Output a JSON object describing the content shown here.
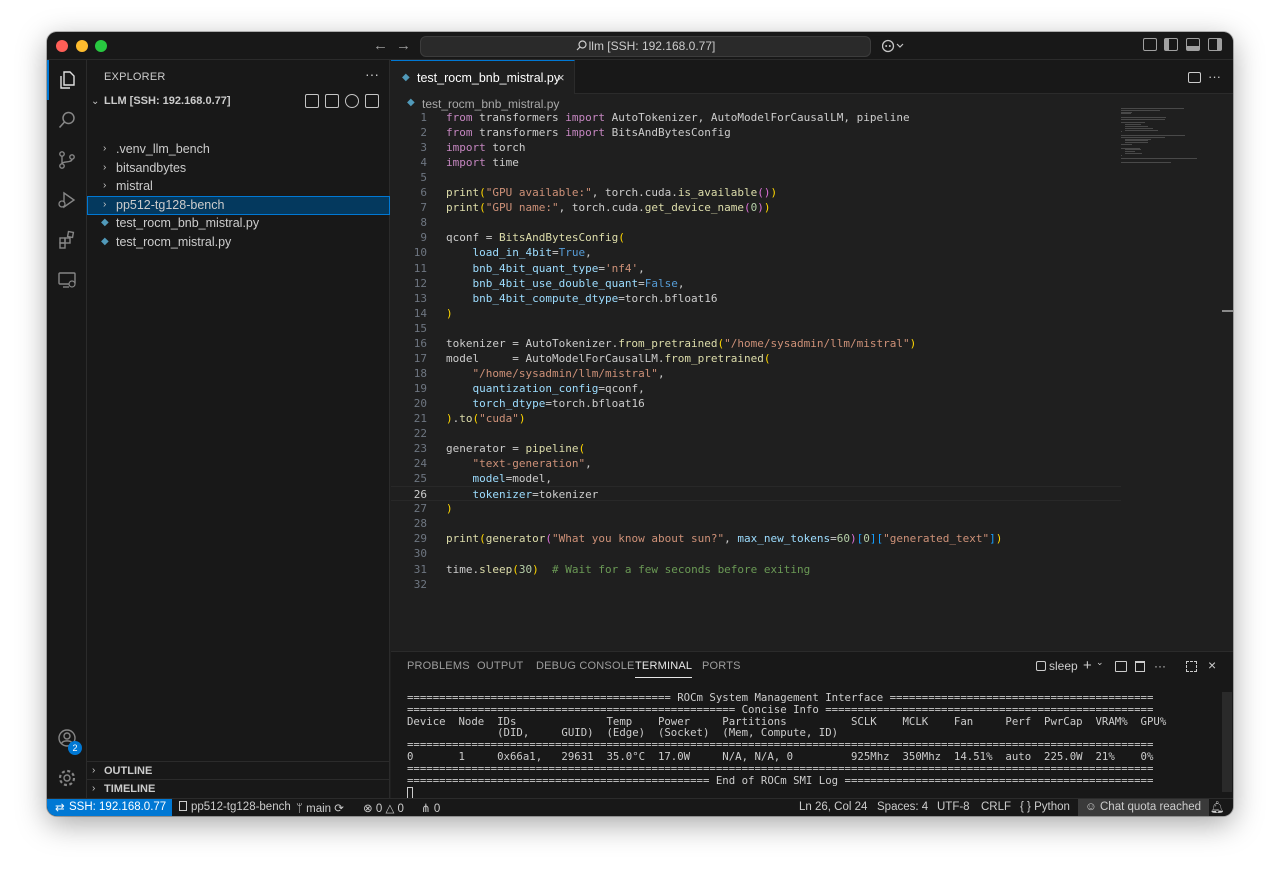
{
  "titlebar": {
    "command_center": "llm [SSH: 192.168.0.77]",
    "back_glyph": "←",
    "forward_glyph": "→"
  },
  "activity_bar": {
    "accounts_badge": "2"
  },
  "explorer": {
    "title": "EXPLORER",
    "more": "···",
    "root": "LLM [SSH: 192.168.0.77]",
    "items": [
      {
        "label": ".venv_llm_bench",
        "type": "folder"
      },
      {
        "label": "bitsandbytes",
        "type": "folder"
      },
      {
        "label": "mistral",
        "type": "folder"
      },
      {
        "label": "pp512-tg128-bench",
        "type": "folder",
        "selected": true
      },
      {
        "label": "test_rocm_bnb_mistral.py",
        "type": "python-file"
      },
      {
        "label": "test_rocm_mistral.py",
        "type": "python-file"
      }
    ],
    "outline": "OUTLINE",
    "timeline": "TIMELINE"
  },
  "editor": {
    "tab_label": "test_rocm_bnb_mistral.py",
    "tab_close": "×",
    "breadcrumb": "test_rocm_bnb_mistral.py",
    "current_line": 26,
    "lines": [
      [
        [
          "kw",
          "from"
        ],
        [
          "plain",
          " transformers "
        ],
        [
          "kw",
          "import"
        ],
        [
          "plain",
          " AutoTokenizer, AutoModelForCausalLM, pipeline"
        ]
      ],
      [
        [
          "kw",
          "from"
        ],
        [
          "plain",
          " transformers "
        ],
        [
          "kw",
          "import"
        ],
        [
          "plain",
          " BitsAndBytesConfig"
        ]
      ],
      [
        [
          "kw",
          "import"
        ],
        [
          "plain",
          " torch"
        ]
      ],
      [
        [
          "kw",
          "import"
        ],
        [
          "plain",
          " time"
        ]
      ],
      [],
      [
        [
          "fn",
          "print"
        ],
        [
          "br1",
          "("
        ],
        [
          "str",
          "\"GPU available:\""
        ],
        [
          "plain",
          ", torch.cuda."
        ],
        [
          "fn",
          "is_available"
        ],
        [
          "br2",
          "()"
        ],
        [
          "br1",
          ")"
        ]
      ],
      [
        [
          "fn",
          "print"
        ],
        [
          "br1",
          "("
        ],
        [
          "str",
          "\"GPU name:\""
        ],
        [
          "plain",
          ", torch.cuda."
        ],
        [
          "fn",
          "get_device_name"
        ],
        [
          "br2",
          "("
        ],
        [
          "num",
          "0"
        ],
        [
          "br2",
          ")"
        ],
        [
          "br1",
          ")"
        ]
      ],
      [],
      [
        [
          "plain",
          "qconf = "
        ],
        [
          "fn",
          "BitsAndBytesConfig"
        ],
        [
          "br1",
          "("
        ]
      ],
      [
        [
          "plain",
          "    "
        ],
        [
          "par",
          "load_in_4bit"
        ],
        [
          "plain",
          "="
        ],
        [
          "bool",
          "True"
        ],
        [
          "plain",
          ","
        ]
      ],
      [
        [
          "plain",
          "    "
        ],
        [
          "par",
          "bnb_4bit_quant_type"
        ],
        [
          "plain",
          "="
        ],
        [
          "str",
          "'nf4'"
        ],
        [
          "plain",
          ","
        ]
      ],
      [
        [
          "plain",
          "    "
        ],
        [
          "par",
          "bnb_4bit_use_double_quant"
        ],
        [
          "plain",
          "="
        ],
        [
          "bool",
          "False"
        ],
        [
          "plain",
          ","
        ]
      ],
      [
        [
          "plain",
          "    "
        ],
        [
          "par",
          "bnb_4bit_compute_dtype"
        ],
        [
          "plain",
          "=torch.bfloat16"
        ]
      ],
      [
        [
          "br1",
          ")"
        ]
      ],
      [],
      [
        [
          "plain",
          "tokenizer = AutoTokenizer."
        ],
        [
          "fn",
          "from_pretrained"
        ],
        [
          "br1",
          "("
        ],
        [
          "str",
          "\"/home/sysadmin/llm/mistral\""
        ],
        [
          "br1",
          ")"
        ]
      ],
      [
        [
          "plain",
          "model     = AutoModelForCausalLM."
        ],
        [
          "fn",
          "from_pretrained"
        ],
        [
          "br1",
          "("
        ]
      ],
      [
        [
          "plain",
          "    "
        ],
        [
          "str",
          "\"/home/sysadmin/llm/mistral\""
        ],
        [
          "plain",
          ","
        ]
      ],
      [
        [
          "plain",
          "    "
        ],
        [
          "par",
          "quantization_config"
        ],
        [
          "plain",
          "=qconf,"
        ]
      ],
      [
        [
          "plain",
          "    "
        ],
        [
          "par",
          "torch_dtype"
        ],
        [
          "plain",
          "=torch.bfloat16"
        ]
      ],
      [
        [
          "br1",
          ")"
        ],
        [
          "plain",
          "."
        ],
        [
          "fn",
          "to"
        ],
        [
          "br1",
          "("
        ],
        [
          "str",
          "\"cuda\""
        ],
        [
          "br1",
          ")"
        ]
      ],
      [],
      [
        [
          "plain",
          "generator = "
        ],
        [
          "fn",
          "pipeline"
        ],
        [
          "br1",
          "("
        ]
      ],
      [
        [
          "plain",
          "    "
        ],
        [
          "str",
          "\"text-generation\""
        ],
        [
          "plain",
          ","
        ]
      ],
      [
        [
          "plain",
          "    "
        ],
        [
          "par",
          "model"
        ],
        [
          "plain",
          "=model,"
        ]
      ],
      [
        [
          "plain",
          "    "
        ],
        [
          "par",
          "tokenizer"
        ],
        [
          "plain",
          "=tokenizer"
        ]
      ],
      [
        [
          "br1",
          ")"
        ]
      ],
      [],
      [
        [
          "fn",
          "print"
        ],
        [
          "br1",
          "("
        ],
        [
          "fn",
          "generator"
        ],
        [
          "br2",
          "("
        ],
        [
          "str",
          "\"What you know about sun?\""
        ],
        [
          "plain",
          ", "
        ],
        [
          "par",
          "max_new_tokens"
        ],
        [
          "plain",
          "="
        ],
        [
          "num",
          "60"
        ],
        [
          "br2",
          ")"
        ],
        [
          "br3",
          "["
        ],
        [
          "num",
          "0"
        ],
        [
          "br3",
          "]["
        ],
        [
          "str",
          "\"generated_text\""
        ],
        [
          "br3",
          "]"
        ],
        [
          "br1",
          ")"
        ]
      ],
      [],
      [
        [
          "plain",
          "time."
        ],
        [
          "fn",
          "sleep"
        ],
        [
          "br1",
          "("
        ],
        [
          "num",
          "30"
        ],
        [
          "br1",
          ")"
        ],
        [
          "plain",
          "  "
        ],
        [
          "cmt",
          "# Wait for a few seconds before exiting"
        ]
      ],
      []
    ]
  },
  "panel": {
    "tabs": [
      "PROBLEMS",
      "OUTPUT",
      "DEBUG CONSOLE",
      "TERMINAL",
      "PORTS"
    ],
    "active_tab": "TERMINAL",
    "terminal_name": "sleep",
    "terminal_lines": [
      "========================================= ROCm System Management Interface =========================================",
      "=================================================== Concise Info ===================================================",
      "Device  Node  IDs              Temp    Power     Partitions          SCLK    MCLK    Fan     Perf  PwrCap  VRAM%  GPU%",
      "              (DID,     GUID)  (Edge)  (Socket)  (Mem, Compute, ID)",
      "====================================================================================================================",
      "0       1     0x66a1,   29631  35.0°C  17.0W     N/A, N/A, 0         925Mhz  350Mhz  14.51%  auto  225.0W  21%    0%",
      "====================================================================================================================",
      "=============================================== End of ROCm SMI Log ================================================"
    ]
  },
  "statusbar": {
    "remote": "SSH: 192.168.0.77",
    "folder": "pp512-tg128-bench",
    "branch": "main",
    "errors": "0",
    "warnings": "0",
    "ports": "0",
    "position": "Ln 26, Col 24",
    "spaces": "Spaces: 4",
    "encoding": "UTF-8",
    "eol": "CRLF",
    "language": "Python",
    "language_prefix": "{ }",
    "chat": "Chat quota reached"
  }
}
